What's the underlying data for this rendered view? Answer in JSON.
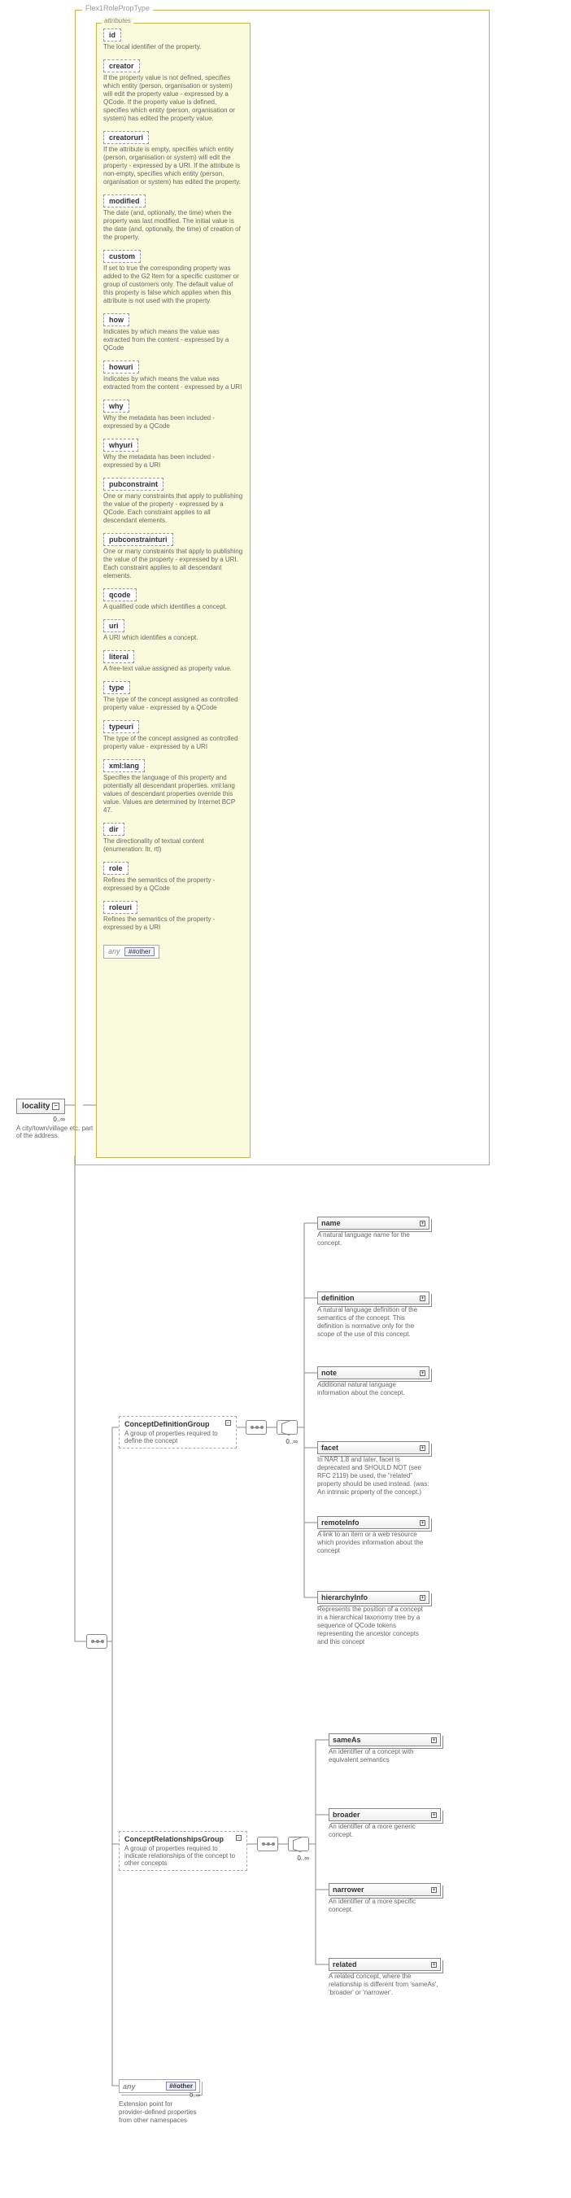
{
  "root": {
    "name": "locality",
    "cardinality": "0..∞",
    "desc": "A city/town/village etc. part of the address."
  },
  "type_name": "Flex1RolePropType",
  "attrs_label": "attributes",
  "attributes": [
    {
      "name": "id",
      "desc": "The local identifier of the property."
    },
    {
      "name": "creator",
      "desc": "If the property value is not defined, specifies which entity (person, organisation or system) will edit the property value - expressed by a QCode. If the property value is defined, specifies which entity (person, organisation or system) has edited the property value."
    },
    {
      "name": "creatoruri",
      "desc": "If the attribute is empty, specifies which entity (person, organisation or system) will edit the property - expressed by a URI. If the attribute is non-empty, specifies which entity (person, organisation or system) has edited the property."
    },
    {
      "name": "modified",
      "desc": "The date (and, optionally, the time) when the property was last modified. The initial value is the date (and, optionally, the time) of creation of the property."
    },
    {
      "name": "custom",
      "desc": "If set to true the corresponding property was added to the G2 Item for a specific customer or group of customers only. The default value of this property is false which applies when this attribute is not used with the property."
    },
    {
      "name": "how",
      "desc": "Indicates by which means the value was extracted from the content - expressed by a QCode"
    },
    {
      "name": "howuri",
      "desc": "Indicates by which means the value was extracted from the content - expressed by a URI"
    },
    {
      "name": "why",
      "desc": "Why the metadata has been included - expressed by a QCode"
    },
    {
      "name": "whyuri",
      "desc": "Why the metadata has been included - expressed by a URI"
    },
    {
      "name": "pubconstraint",
      "desc": "One or many constraints that apply to publishing the value of the property - expressed by a QCode. Each constraint applies to all descendant elements."
    },
    {
      "name": "pubconstrainturi",
      "desc": "One or many constraints that apply to publishing the value of the property - expressed by a URI. Each constraint applies to all descendant elements."
    },
    {
      "name": "qcode",
      "desc": "A qualified code which identifies a concept."
    },
    {
      "name": "uri",
      "desc": "A URI which identifies a concept."
    },
    {
      "name": "literal",
      "desc": "A free-text value assigned as property value."
    },
    {
      "name": "type",
      "desc": "The type of the concept assigned as controlled property value - expressed by a QCode"
    },
    {
      "name": "typeuri",
      "desc": "The type of the concept assigned as controlled property value - expressed by a URI"
    },
    {
      "name": "xml:lang",
      "desc": "Specifies the language of this property and potentially all descendant properties. xml:lang values of descendant properties override this value. Values are determined by Internet BCP 47."
    },
    {
      "name": "dir",
      "desc": "The directionality of textual content (enumeration: ltr, rtl)"
    },
    {
      "name": "role",
      "desc": "Refines the semantics of the property - expressed by a QCode"
    },
    {
      "name": "roleuri",
      "desc": "Refines the semantics of the property - expressed by a URI"
    }
  ],
  "any_other_label": "any",
  "any_other_tag": "##other",
  "groups": {
    "definition": {
      "name": "ConceptDefinitionGroup",
      "desc": "A group of properties required to define the concept",
      "card": "0..∞",
      "children": [
        {
          "name": "name",
          "desc": "A natural language name for the concept."
        },
        {
          "name": "definition",
          "desc": "A natural language definition of the semantics of the concept. This definition is normative only for the scope of the use of this concept."
        },
        {
          "name": "note",
          "desc": "Additional natural language information about the concept."
        },
        {
          "name": "facet",
          "desc": "In NAR 1.8 and later, facet is deprecated and SHOULD NOT (see RFC 2119) be used, the \"related\" property should be used instead. (was: An intrinsic property of the concept.)"
        },
        {
          "name": "remoteInfo",
          "desc": "A link to an item or a web resource which provides information about the concept"
        },
        {
          "name": "hierarchyInfo",
          "desc": "Represents the position of a concept in a hierarchical taxonomy tree by a sequence of QCode tokens representing the ancestor concepts and this concept"
        }
      ]
    },
    "relationships": {
      "name": "ConceptRelationshipsGroup",
      "desc": "A group of properties required to indicate relationships of the concept to other concepts",
      "card": "0..∞",
      "children": [
        {
          "name": "sameAs",
          "desc": "An identifier of a concept with equivalent semantics"
        },
        {
          "name": "broader",
          "desc": "An identifier of a more generic concept."
        },
        {
          "name": "narrower",
          "desc": "An identifier of a more specific concept."
        },
        {
          "name": "related",
          "desc": "A related concept, where the relationship is different from 'sameAs', 'broader' or 'narrower'."
        }
      ]
    }
  },
  "bottom_any": {
    "label": "any",
    "tag": "##other",
    "card": "0..∞",
    "desc": "Extension point for provider-defined properties from other namespaces"
  }
}
